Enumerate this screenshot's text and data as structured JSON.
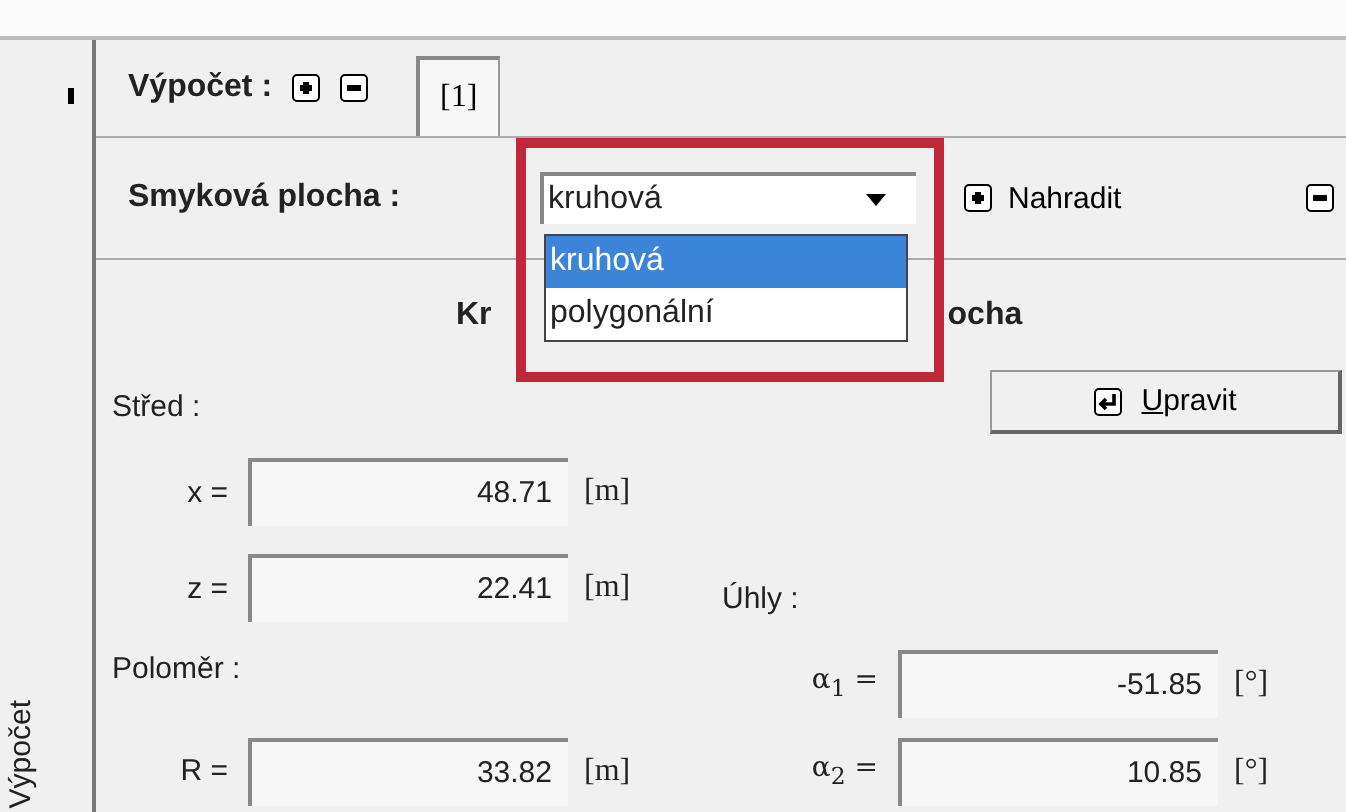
{
  "sidebar": {
    "label": "Výpočet"
  },
  "calculation": {
    "label": "Výpočet :",
    "tabs": [
      {
        "label": "[1]",
        "selected": true
      }
    ]
  },
  "slip_surface": {
    "label": "Smyková plocha :",
    "combo": {
      "value": "kruhová",
      "open": true,
      "options": [
        {
          "label": "kruhová",
          "selected": true
        },
        {
          "label": "polygonální",
          "selected": false
        }
      ]
    },
    "replace_button": "Nahradit"
  },
  "heading_fragments": [
    "Kr",
    "ocha"
  ],
  "edit_button": {
    "label": "Upravit"
  },
  "center": {
    "label": "Střed :",
    "fields": [
      {
        "label": "x =",
        "value": "48.71",
        "unit": "[m]"
      },
      {
        "label": "z =",
        "value": "22.41",
        "unit": "[m]"
      }
    ]
  },
  "radius": {
    "label": "Poloměr :",
    "field": {
      "label": "R =",
      "value": "33.82",
      "unit": "[m]"
    }
  },
  "angles": {
    "label": "Úhly :",
    "fields": [
      {
        "label": "α$_{1}$ =",
        "value": "-51.85",
        "unit": "[°]"
      },
      {
        "label": "α$_{2}$ =",
        "value": "10.85",
        "unit": "[°]"
      }
    ]
  }
}
